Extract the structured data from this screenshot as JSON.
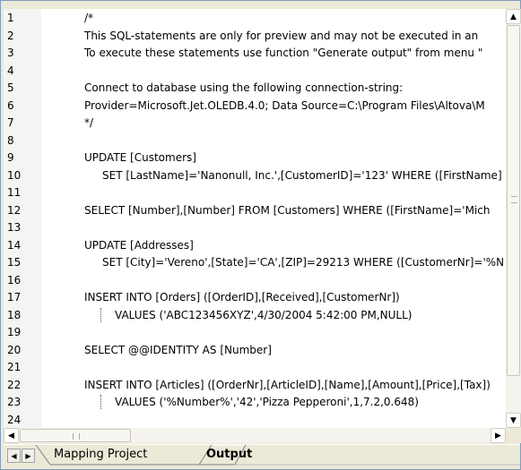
{
  "editor": {
    "lines": [
      {
        "n": "1",
        "code": "/*",
        "indent": 0
      },
      {
        "n": "2",
        "code": "This SQL-statements are only for preview and may not be executed in an",
        "indent": 0
      },
      {
        "n": "3",
        "code": "To execute these statements use function \"Generate output\" from menu \"",
        "indent": 0
      },
      {
        "n": "4",
        "code": "",
        "indent": 0
      },
      {
        "n": "5",
        "code": "Connect to database using the following connection-string:",
        "indent": 0
      },
      {
        "n": "6",
        "code": "Provider=Microsoft.Jet.OLEDB.4.0; Data Source=C:\\Program Files\\Altova\\M",
        "indent": 0
      },
      {
        "n": "7",
        "code": "*/",
        "indent": 0
      },
      {
        "n": "8",
        "code": "",
        "indent": 0
      },
      {
        "n": "9",
        "code": "UPDATE [Customers]",
        "indent": 0
      },
      {
        "n": "10",
        "code": "SET [LastName]='Nanonull, Inc.',[CustomerID]='123' WHERE ([FirstName]",
        "indent": 1
      },
      {
        "n": "11",
        "code": "",
        "indent": 0
      },
      {
        "n": "12",
        "code": "SELECT [Number],[Number] FROM [Customers] WHERE ([FirstName]='Mich",
        "indent": 0
      },
      {
        "n": "13",
        "code": "",
        "indent": 0
      },
      {
        "n": "14",
        "code": "UPDATE [Addresses]",
        "indent": 0
      },
      {
        "n": "15",
        "code": "SET [City]='Vereno',[State]='CA',[ZIP]=29213 WHERE ([CustomerNr]='%N",
        "indent": 1
      },
      {
        "n": "16",
        "code": "",
        "indent": 0
      },
      {
        "n": "17",
        "code": "INSERT INTO [Orders] ([OrderID],[Received],[CustomerNr])",
        "indent": 0
      },
      {
        "n": "18",
        "code": "VALUES ('ABC123456XYZ',4/30/2004 5:42:00 PM,NULL)",
        "indent": 2
      },
      {
        "n": "19",
        "code": "",
        "indent": 0
      },
      {
        "n": "20",
        "code": "SELECT @@IDENTITY AS [Number]",
        "indent": 0
      },
      {
        "n": "21",
        "code": "",
        "indent": 0
      },
      {
        "n": "22",
        "code": "INSERT INTO [Articles] ([OrderNr],[ArticleID],[Name],[Amount],[Price],[Tax])",
        "indent": 0
      },
      {
        "n": "23",
        "code": "VALUES ('%Number%','42','Pizza Pepperoni',1,7.2,0.648)",
        "indent": 2
      },
      {
        "n": "24",
        "code": "",
        "indent": 0
      }
    ]
  },
  "scrollbars": {
    "vertical": {
      "up_icon": "arrow-up-icon",
      "down_icon": "arrow-down-icon"
    },
    "horizontal": {
      "left_icon": "arrow-left-icon",
      "right_icon": "arrow-right-icon"
    }
  },
  "tabs": {
    "items": [
      {
        "label": "Mapping Project",
        "active": false
      },
      {
        "label": "Output",
        "active": true
      }
    ],
    "prev_icon": "tab-prev-icon",
    "next_icon": "tab-next-icon"
  }
}
